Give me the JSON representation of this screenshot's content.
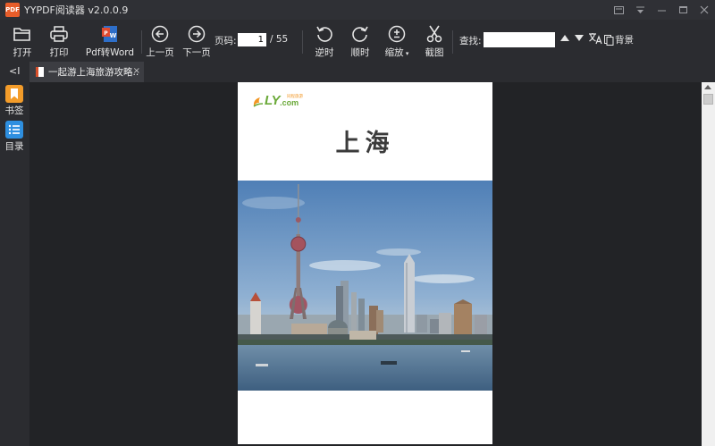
{
  "app": {
    "logo_text": "PDF",
    "title": "YYPDF阅读器 v2.0.0.9"
  },
  "window_controls": [
    "skin-icon",
    "menu-icon",
    "minimize-icon",
    "maximize-icon",
    "close-icon"
  ],
  "toolbar": {
    "open_label": "打开",
    "print_label": "打印",
    "pdf_to_word_label": "Pdf转Word",
    "prev_page_label": "上一页",
    "next_page_label": "下一页",
    "page_label": "页码:",
    "page_current": "1",
    "page_total": "/ 55",
    "rotate_ccw_label": "逆时",
    "rotate_cw_label": "顺时",
    "zoom_label": "缩放",
    "screenshot_label": "截图",
    "find_label": "查找:",
    "find_value": "",
    "background_label": "背景"
  },
  "tabs": [
    {
      "title": "一起游上海旅游攻略..",
      "close": "×"
    }
  ],
  "sidebar": {
    "collapse": "<I",
    "items": [
      {
        "label": "书签",
        "icon": "bookmark-icon",
        "color": "#f39c2a"
      },
      {
        "label": "目录",
        "icon": "list-icon",
        "color": "#2e8fe0"
      }
    ]
  },
  "document": {
    "logo_main": "LY",
    "logo_com": ".com",
    "logo_cn": "同程旅游",
    "heading": "上海",
    "image": "shanghai-skyline-photo"
  },
  "colors": {
    "accent_orange": "#e85d2a",
    "ly_green": "#6aa938",
    "bookmark_orange": "#f39c2a",
    "toc_blue": "#2e8fe0"
  }
}
